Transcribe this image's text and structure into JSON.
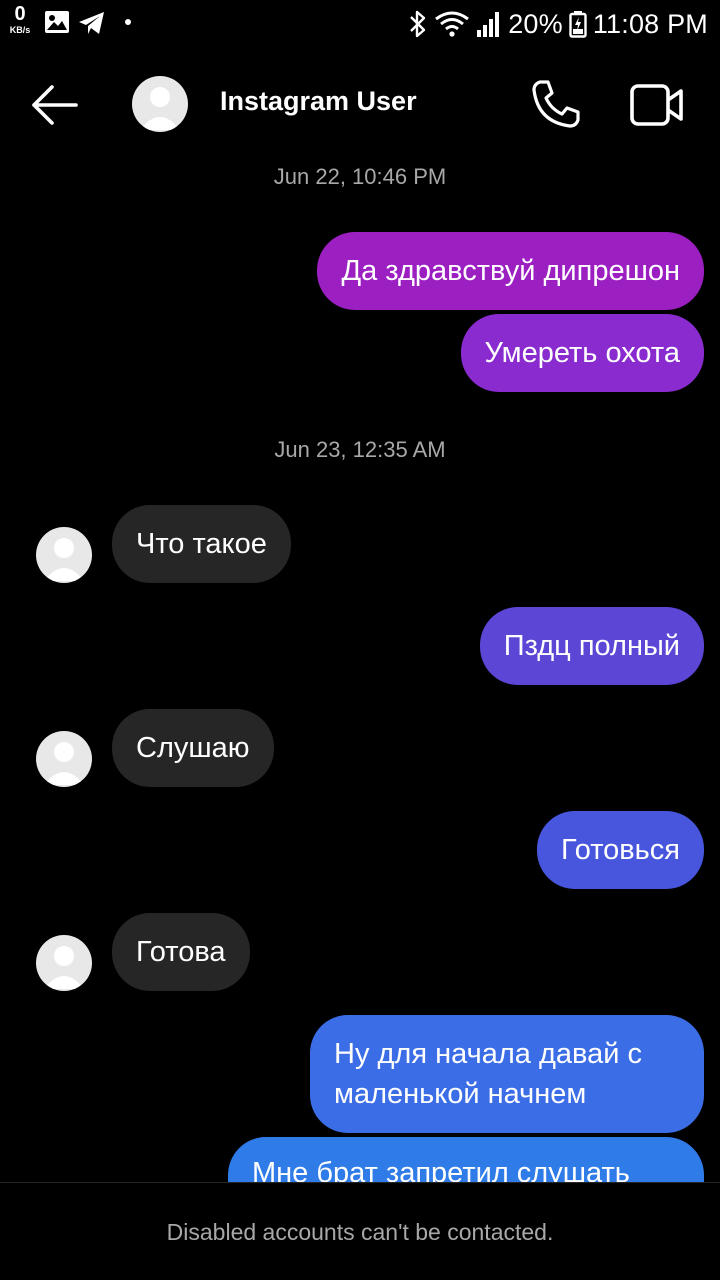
{
  "status_bar": {
    "data_speed_value": "0",
    "data_speed_unit": "KB/s",
    "battery_percent": "20%",
    "time": "11:08 PM",
    "icons": [
      "gallery-icon",
      "telegram-icon",
      "dot-icon",
      "bluetooth-icon",
      "wifi-icon",
      "signal-icon",
      "battery-icon"
    ]
  },
  "header": {
    "username": "Instagram User",
    "icons": [
      "back-arrow-icon",
      "avatar",
      "phone-icon",
      "video-camera-icon"
    ]
  },
  "conversation": {
    "timestamps": [
      "Jun 22, 10:46 PM",
      "Jun 23, 12:35 AM"
    ],
    "messages": [
      {
        "side": "outgoing",
        "text": "Да здравствуй дипрешон",
        "color": "#9b1fc1"
      },
      {
        "side": "outgoing",
        "text": "Умереть охота",
        "color": "#8a2bcf"
      },
      {
        "side": "incoming",
        "text": "Что такое",
        "color": "#262626"
      },
      {
        "side": "outgoing",
        "text": "Пздц полный",
        "color": "#5b46d6"
      },
      {
        "side": "incoming",
        "text": "Слушаю",
        "color": "#262626"
      },
      {
        "side": "outgoing",
        "text": "Готовься",
        "color": "#4756dc"
      },
      {
        "side": "incoming",
        "text": "Готова",
        "color": "#262626"
      },
      {
        "side": "outgoing",
        "text": "Ну для начала давай с маленькой начнем",
        "color": "#3b6ee6"
      },
      {
        "side": "outgoing",
        "text": "Мне брат запретил слушать",
        "color": "#2f7be8"
      }
    ]
  },
  "footer": {
    "notice": "Disabled accounts can't be contacted."
  },
  "colors": {
    "background": "#000000",
    "incoming_bubble": "#262626",
    "timestamp_text": "#a8a8a8"
  }
}
